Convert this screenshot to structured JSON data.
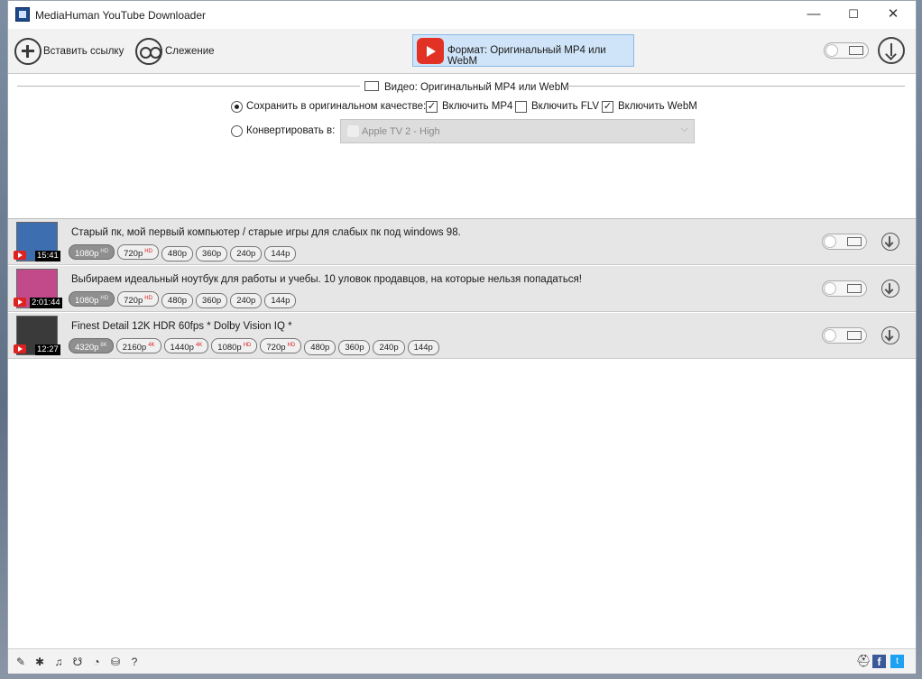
{
  "window": {
    "title": "MediaHuman YouTube Downloader",
    "minimize": "—",
    "maximize": "☐",
    "close": "✕"
  },
  "toolbar": {
    "paste_label": "Вставить ссылку",
    "tracking_label": "Слежение",
    "format_label": "Формат: Оригинальный MP4 или WebM"
  },
  "format_panel": {
    "section_title": "Видео: Оригинальный MP4 или WebM",
    "save_original_label": "Сохранить в оригинальном качестве:",
    "include_mp4_label": "Включить MP4",
    "include_mp4_checked": true,
    "include_flv_label": "Включить FLV",
    "include_flv_checked": false,
    "include_webm_label": "Включить WebM",
    "include_webm_checked": true,
    "convert_label": "Конвертировать в:",
    "convert_value": "Apple TV 2 - High"
  },
  "videos": [
    {
      "title": "Старый пк, мой первый компьютер / старые игры для слабых пк под windows 98.",
      "duration": "15:41",
      "thumb_color": "#3d6fb0",
      "qualities": [
        {
          "label": "1080p",
          "tag": "HD",
          "selected": true
        },
        {
          "label": "720p",
          "tag": "HD",
          "selected": false
        },
        {
          "label": "480p",
          "tag": "",
          "selected": false
        },
        {
          "label": "360p",
          "tag": "",
          "selected": false
        },
        {
          "label": "240p",
          "tag": "",
          "selected": false
        },
        {
          "label": "144p",
          "tag": "",
          "selected": false
        }
      ]
    },
    {
      "title": "Выбираем идеальный ноутбук для работы и учебы. 10 уловок продавцов, на которые нельзя попадаться!",
      "duration": "2:01:44",
      "thumb_color": "#c24a8a",
      "qualities": [
        {
          "label": "1080p",
          "tag": "HD",
          "selected": true
        },
        {
          "label": "720p",
          "tag": "HD",
          "selected": false
        },
        {
          "label": "480p",
          "tag": "",
          "selected": false
        },
        {
          "label": "360p",
          "tag": "",
          "selected": false
        },
        {
          "label": "240p",
          "tag": "",
          "selected": false
        },
        {
          "label": "144p",
          "tag": "",
          "selected": false
        }
      ]
    },
    {
      "title": "Finest Detail 12K HDR 60fps * Dolby Vision IQ *",
      "duration": "12:27",
      "thumb_color": "#3a3a3a",
      "qualities": [
        {
          "label": "4320p",
          "tag": "8K",
          "selected": true
        },
        {
          "label": "2160p",
          "tag": "4K",
          "selected": false
        },
        {
          "label": "1440p",
          "tag": "4K",
          "selected": false
        },
        {
          "label": "1080p",
          "tag": "HD",
          "selected": false
        },
        {
          "label": "720p",
          "tag": "HD",
          "selected": false
        },
        {
          "label": "480p",
          "tag": "",
          "selected": false
        },
        {
          "label": "360p",
          "tag": "",
          "selected": false
        },
        {
          "label": "240p",
          "tag": "",
          "selected": false
        },
        {
          "label": "144p",
          "tag": "",
          "selected": false
        }
      ]
    }
  ],
  "statusbar": {
    "icons": [
      "tools-icon",
      "gear-icon",
      "music-icon",
      "snail-icon",
      "clock-icon",
      "binoculars-icon",
      "help-icon"
    ],
    "glyphs": [
      "✎",
      "✱",
      "♫",
      "☋",
      "◔",
      "⛁",
      "?"
    ],
    "facebook": "f",
    "twitter": "t"
  },
  "colors": {
    "accent": "#cfe4f8",
    "youtube_red": "#e23226"
  }
}
